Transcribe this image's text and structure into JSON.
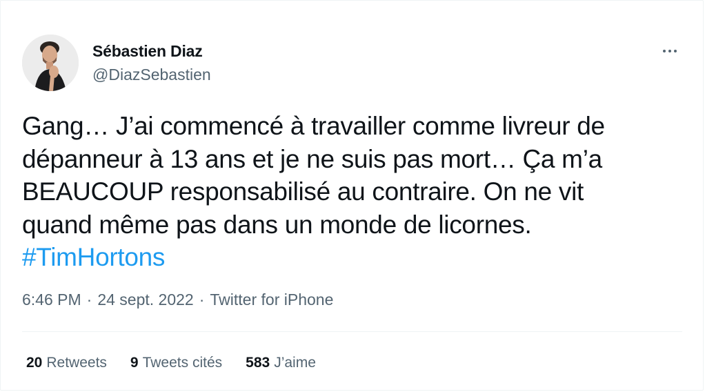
{
  "author": {
    "name": "Sébastien Diaz",
    "handle": "@DiazSebastien",
    "avatar_icon": "profile-photo"
  },
  "menu_icon": "more-horizontal-icon",
  "tweet": {
    "lines": [
      "Gang… J’ai commencé à travailler comme livreur de",
      "dépanneur à 13 ans et je ne suis pas mort… Ça m’a",
      "BEAUCOUP responsabilisé au contraire. On ne vit",
      "quand même pas dans un monde de licornes."
    ],
    "hashtag": "#TimHortons"
  },
  "meta": {
    "time": "6:46 PM",
    "separator": "·",
    "date": "24 sept. 2022",
    "source": "Twitter for iPhone"
  },
  "stats": {
    "retweets": {
      "count": "20",
      "label": "Retweets"
    },
    "quotes": {
      "count": "9",
      "label": "Tweets cités"
    },
    "likes": {
      "count": "583",
      "label": "J’aime"
    }
  },
  "colors": {
    "link": "#1d9bf0",
    "secondary_text": "#536471",
    "primary_text": "#0f1419",
    "divider": "#eff3f4"
  }
}
